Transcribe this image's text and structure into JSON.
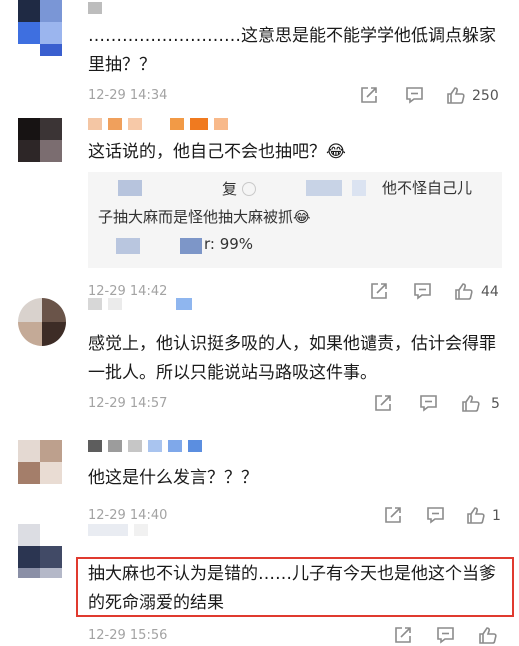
{
  "comments": [
    {
      "text": "………………………这意思是能不能学学他低调点躲家里抽？？",
      "time": "12-29 14:34",
      "like_count": "250"
    },
    {
      "text": "这话说的，他自己不会也抽吧？😂",
      "quote_reply": "复",
      "quote_text_1": "他不怪自己儿",
      "quote_text_2": "子抽大麻而是怪他抽大麻被抓😂",
      "quote_stat": "r: 99%",
      "time": "12-29 14:42",
      "like_count": "44"
    },
    {
      "text": "感觉上，他认识挺多吸的人，如果他谴责，估计会得罪一批人。所以只能说站马路吸这件事。",
      "time": "12-29 14:57",
      "like_count": "5"
    },
    {
      "text": "他这是什么发言？？？",
      "time": "12-29 14:40",
      "like_count": "1"
    },
    {
      "text": "抽大麻也不认为是错的……儿子有今天也是他这个当爹的死命溺爱的结果",
      "time": "12-29 15:56",
      "like_count": ""
    }
  ],
  "colors": {
    "highlight_border": "#e03a2f",
    "meta_gray": "#a3a3a3",
    "quote_bg": "#f5f5f5"
  },
  "icons": [
    "share-icon",
    "comment-icon",
    "like-icon"
  ]
}
